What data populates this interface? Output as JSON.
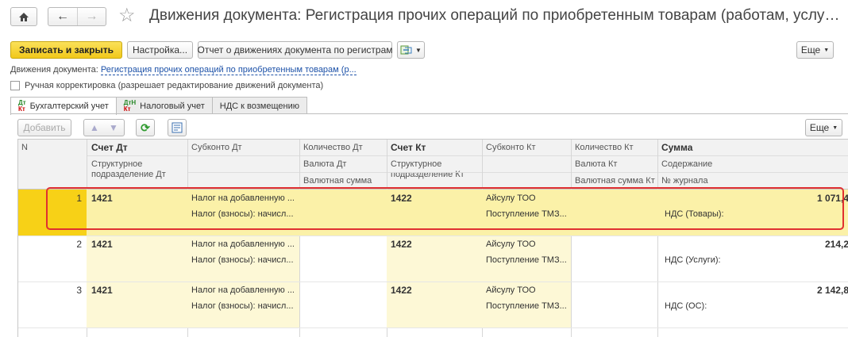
{
  "window": {
    "title": "Движения документа: Регистрация прочих операций по приобретенным товарам (работам, услуга..."
  },
  "toolbar": {
    "save_close": "Записать и закрыть",
    "settings": "Настройка...",
    "report": "Отчет о движениях документа по регистрам",
    "more": "Еще"
  },
  "document_link": {
    "prefix": "Движения документа:",
    "link": "Регистрация прочих операций по приобретенным товарам (р..."
  },
  "manual_adjust": {
    "label": "Ручная корректировка (разрешает редактирование движений документа)",
    "checked": false
  },
  "tabs": [
    {
      "label": "Бухгалтерский учет",
      "active": true
    },
    {
      "label": "Налоговый учет",
      "active": false
    },
    {
      "label": "НДС к возмещению",
      "active": false
    }
  ],
  "grid_toolbar": {
    "add": "Добавить",
    "more": "Еще"
  },
  "columns": {
    "n": "N",
    "account_dt": "Счет Дт",
    "subconto_dt": "Субконто Дт",
    "qty_dt": "Количество Дт",
    "account_kt": "Счет Кт",
    "subconto_kt": "Субконто Кт",
    "qty_kt": "Количество Кт",
    "sum": "Сумма",
    "dept_dt": "Структурное подразделение Дт",
    "currency_dt": "Валюта Дт",
    "currency_sum_dt": "Валютная сумма",
    "dept_kt": "Структурное подразделение Кт",
    "currency_kt": "Валюта Кт",
    "currency_sum_kt": "Валютная сумма Кт",
    "content": "Содержание",
    "journal": "№ журнала"
  },
  "rows": [
    {
      "n": "1",
      "account_dt": "1421",
      "subconto_dt_1": "Налог на добавленную ...",
      "subconto_dt_2": "Налог (взносы): начисл...",
      "account_kt": "1422",
      "subconto_kt_1": "Айсулу ТОО",
      "subconto_kt_2": "Поступление ТМЗ...",
      "sum": "1 071,4",
      "content": "НДС (Товары):"
    },
    {
      "n": "2",
      "account_dt": "1421",
      "subconto_dt_1": "Налог на добавленную ...",
      "subconto_dt_2": "Налог (взносы): начисл...",
      "account_kt": "1422",
      "subconto_kt_1": "Айсулу ТОО",
      "subconto_kt_2": "Поступление ТМЗ...",
      "sum": "214,2",
      "content": "НДС (Услуги):"
    },
    {
      "n": "3",
      "account_dt": "1421",
      "subconto_dt_1": "Налог на добавленную ...",
      "subconto_dt_2": "Налог (взносы): начисл...",
      "account_kt": "1422",
      "subconto_kt_1": "Айсулу ТОО",
      "subconto_kt_2": "Поступление ТМЗ...",
      "sum": "2 142,8",
      "content": "НДС (ОС):"
    }
  ]
}
